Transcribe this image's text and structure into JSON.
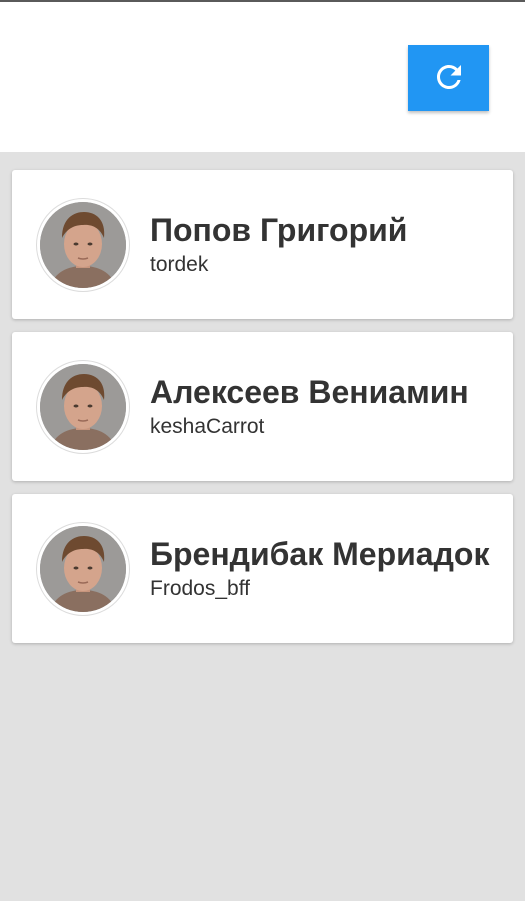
{
  "header": {
    "refresh_icon": "refresh-icon",
    "accent_color": "#2196f3"
  },
  "users": [
    {
      "name": "Попов Григорий",
      "username": "tordek",
      "avatar": "user-photo"
    },
    {
      "name": "Алексеев Вениамин",
      "username": "keshaCarrot",
      "avatar": "user-photo"
    },
    {
      "name": "Брендибак Мериадок",
      "username": "Frodos_bff",
      "avatar": "user-photo"
    }
  ]
}
